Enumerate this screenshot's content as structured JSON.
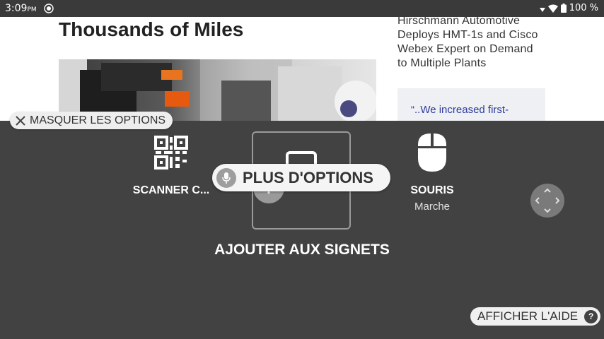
{
  "statusbar": {
    "time": "3:09",
    "ampm": "PM",
    "battery": "100 %"
  },
  "web": {
    "article_title": "Thousands of Miles",
    "side_lines": [
      "Hirschmann Automotive",
      "Deploys HMT-1s and Cisco",
      "Webex Expert on Demand",
      "to Multiple Plants"
    ],
    "quote": "“..We increased first-"
  },
  "overlay": {
    "hide_options": "MASQUER LES OPTIONS",
    "scanner_label": "SCANNER C...",
    "mouse_label": "SOURIS",
    "mouse_state": "Marche",
    "more_options": "PLUS D'OPTIONS",
    "bookmark_label": "AJOUTER AUX SIGNETS",
    "help_label": "AFFICHER L'AIDE",
    "help_icon_text": "?"
  }
}
